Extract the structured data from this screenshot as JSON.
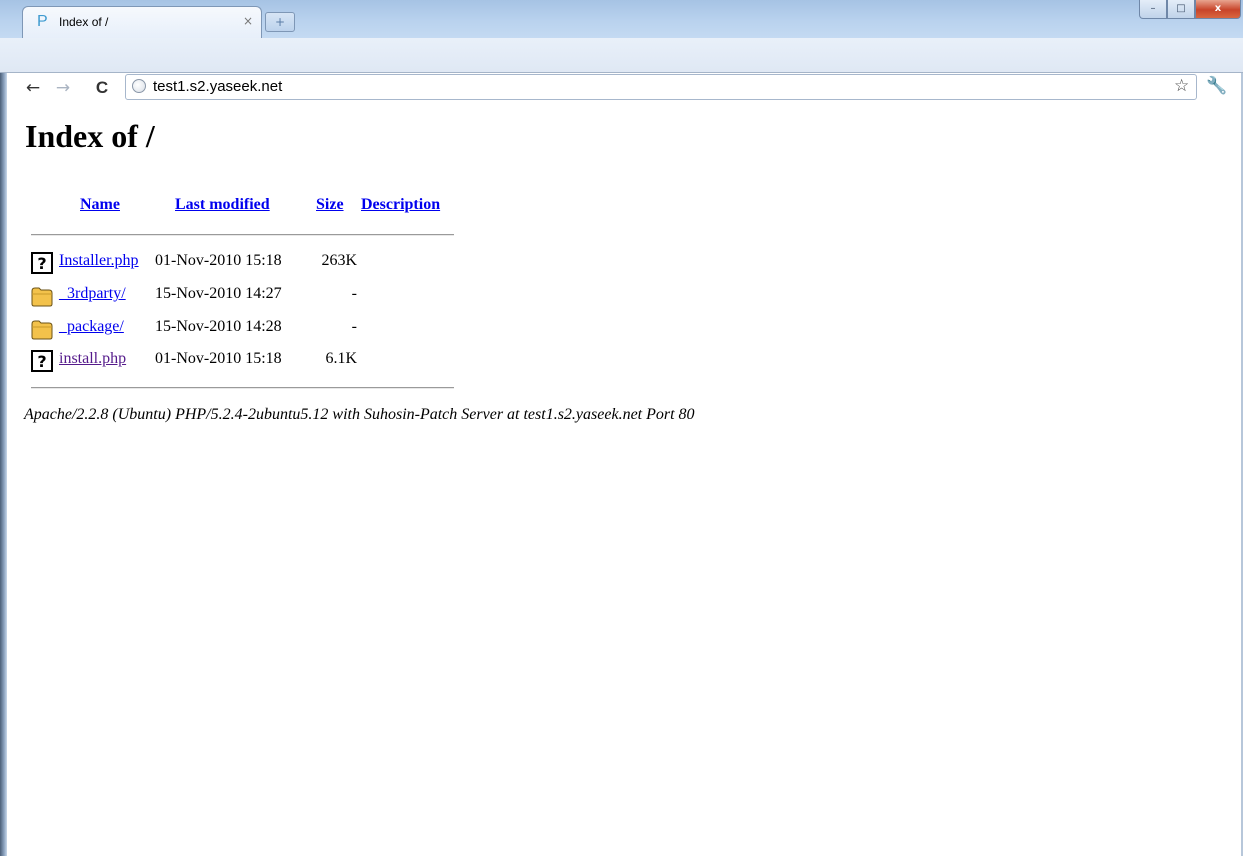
{
  "browser": {
    "tab_title": "Index of /",
    "tab_favicon": "P",
    "tab_close": "×",
    "new_tab": "+",
    "window_buttons": {
      "minimize": "–",
      "maximize": "□",
      "close": "x"
    },
    "nav": {
      "back": "←",
      "forward": "→",
      "reload": "C"
    },
    "url": "test1.s2.yaseek.net",
    "star": "☆",
    "wrench": "🔧"
  },
  "page": {
    "heading": "Index of /",
    "columns": {
      "name": "Name",
      "last_modified": "Last modified",
      "size": "Size",
      "description": "Description"
    },
    "rows": [
      {
        "icon": "unknown-file-icon",
        "name": "Installer.php",
        "modified": "01-Nov-2010 15:18",
        "size": "263K",
        "visited": false
      },
      {
        "icon": "folder-icon",
        "name": "_3rdparty/",
        "modified": "15-Nov-2010 14:27",
        "size": "-",
        "visited": false
      },
      {
        "icon": "folder-icon",
        "name": "_package/",
        "modified": "15-Nov-2010 14:28",
        "size": "-",
        "visited": false
      },
      {
        "icon": "unknown-file-icon",
        "name": "install.php",
        "modified": "01-Nov-2010 15:18",
        "size": "6.1K",
        "visited": true
      }
    ],
    "server_signature": "Apache/2.2.8 (Ubuntu) PHP/5.2.4-2ubuntu5.12 with Suhosin-Patch Server at test1.s2.yaseek.net Port 80"
  },
  "colors": {
    "link": "#0000ee",
    "visited_link": "#551a8b",
    "folder": "#f3c24b"
  }
}
